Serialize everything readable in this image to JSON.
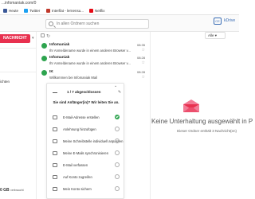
{
  "browser": {
    "url": "...infomaniak.com/0",
    "bookmarks": [
      {
        "label": "Heute",
        "color": "#3b5998"
      },
      {
        "label": "Twitter",
        "color": "#1da1f2"
      },
      {
        "label": "Interflat - lernensu...",
        "color": "#c0392b"
      },
      {
        "label": "Netflix",
        "color": "#e50914"
      }
    ]
  },
  "header": {
    "search_placeholder": "In allen Ordnern suchen",
    "avatar": "CE",
    "kdrive": "kDrive"
  },
  "sidebar": {
    "write_button": "NACHRICHT",
    "text1": "ichten",
    "text2": "",
    "storage_value": "0 GB",
    "storage_note": "verbraucht"
  },
  "mails": [
    {
      "sender": "Infomaniak",
      "preview": "Ihr Anmeldename wurde in einem anderen Browser v...",
      "time": "08:35",
      "dot": "#2ea44f"
    },
    {
      "sender": "Infomaniak",
      "preview": "Ihr Anmeldename wurde in einem anderen Browser v...",
      "time": "08:28",
      "dot": "#2ea44f"
    },
    {
      "sender": "IK",
      "preview": "Willkommen bei Infomaniak Mail",
      "time": "08:28",
      "dot": "#2ea44f"
    }
  ],
  "onboarding": {
    "progress": "1 / 7 abgeschlossen",
    "progress_fraction": 0.14,
    "text": "Sie sind Anfänger(in)? Wir leiten Sie an.",
    "tasks": [
      {
        "label": "E-Mail-Adresse erstellen",
        "done": true
      },
      {
        "label": "Anlehnung hinzufügen",
        "done": false
      },
      {
        "label": "Meine Schreibstelle individuell anpassen",
        "done": false
      },
      {
        "label": "Meine E-Mails synchronisieren",
        "done": false
      },
      {
        "label": "E-Mail verfassen",
        "done": false
      },
      {
        "label": "Auf Konto zugreifen",
        "done": false
      },
      {
        "label": "Mein Konto sichern",
        "done": false
      }
    ]
  },
  "pane": {
    "filter": "Alle",
    "empty_title": "Keine Unterhaltung ausgewählt in P",
    "empty_sub": "Dieser Ordner enthält 3 Nachricht(en)"
  },
  "colors": {
    "accent": "#e8314f",
    "done": "#2ea44f",
    "brand_blue": "#3a6db5"
  }
}
